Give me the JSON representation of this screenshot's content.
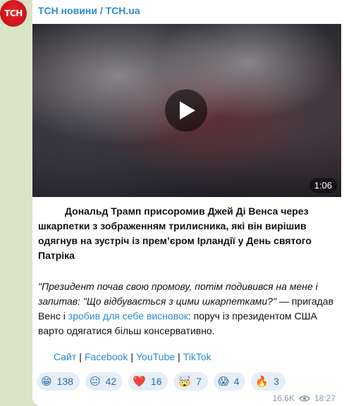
{
  "avatar_text": "TCH",
  "channel": "ТСН новини / TCH.ua",
  "video": {
    "duration": "1:06"
  },
  "headline": "Дональд Трамп присоромив Джей Ді Венса через шкарпетки з зображенням трилисника, які він вирішив одягнув на зустріч із прем’єром Ірландії у День святого Патріка",
  "quote": {
    "italic": "\"Президент почав свою промову, потім подивився на мене і запитав: \"Що відбувається з цими шкарпетками?\"",
    "part1": " — пригадав Венс і ",
    "link_text": "зробив для себе висновок",
    "part2": ": поруч із президентом США варто одягатися більш консервативно."
  },
  "links": {
    "site": "Сайт",
    "facebook": "Facebook",
    "youtube": "YouTube",
    "tiktok": "TikTok",
    "separator": "|"
  },
  "reactions": [
    {
      "emoji": "😁",
      "count": "138"
    },
    {
      "emoji": "😐",
      "count": "42"
    },
    {
      "emoji": "❤️",
      "count": "16"
    },
    {
      "emoji": "🤯",
      "count": "7"
    },
    {
      "emoji": "😱",
      "count": "4"
    },
    {
      "emoji": "🔥",
      "count": "3"
    }
  ],
  "meta": {
    "views": "16.6K",
    "time": "18:27",
    "views_icon": "eye-icon"
  },
  "colors": {
    "accent": "#2a8bd0",
    "background": "#d9e4c9",
    "avatar": "#d0151b"
  }
}
